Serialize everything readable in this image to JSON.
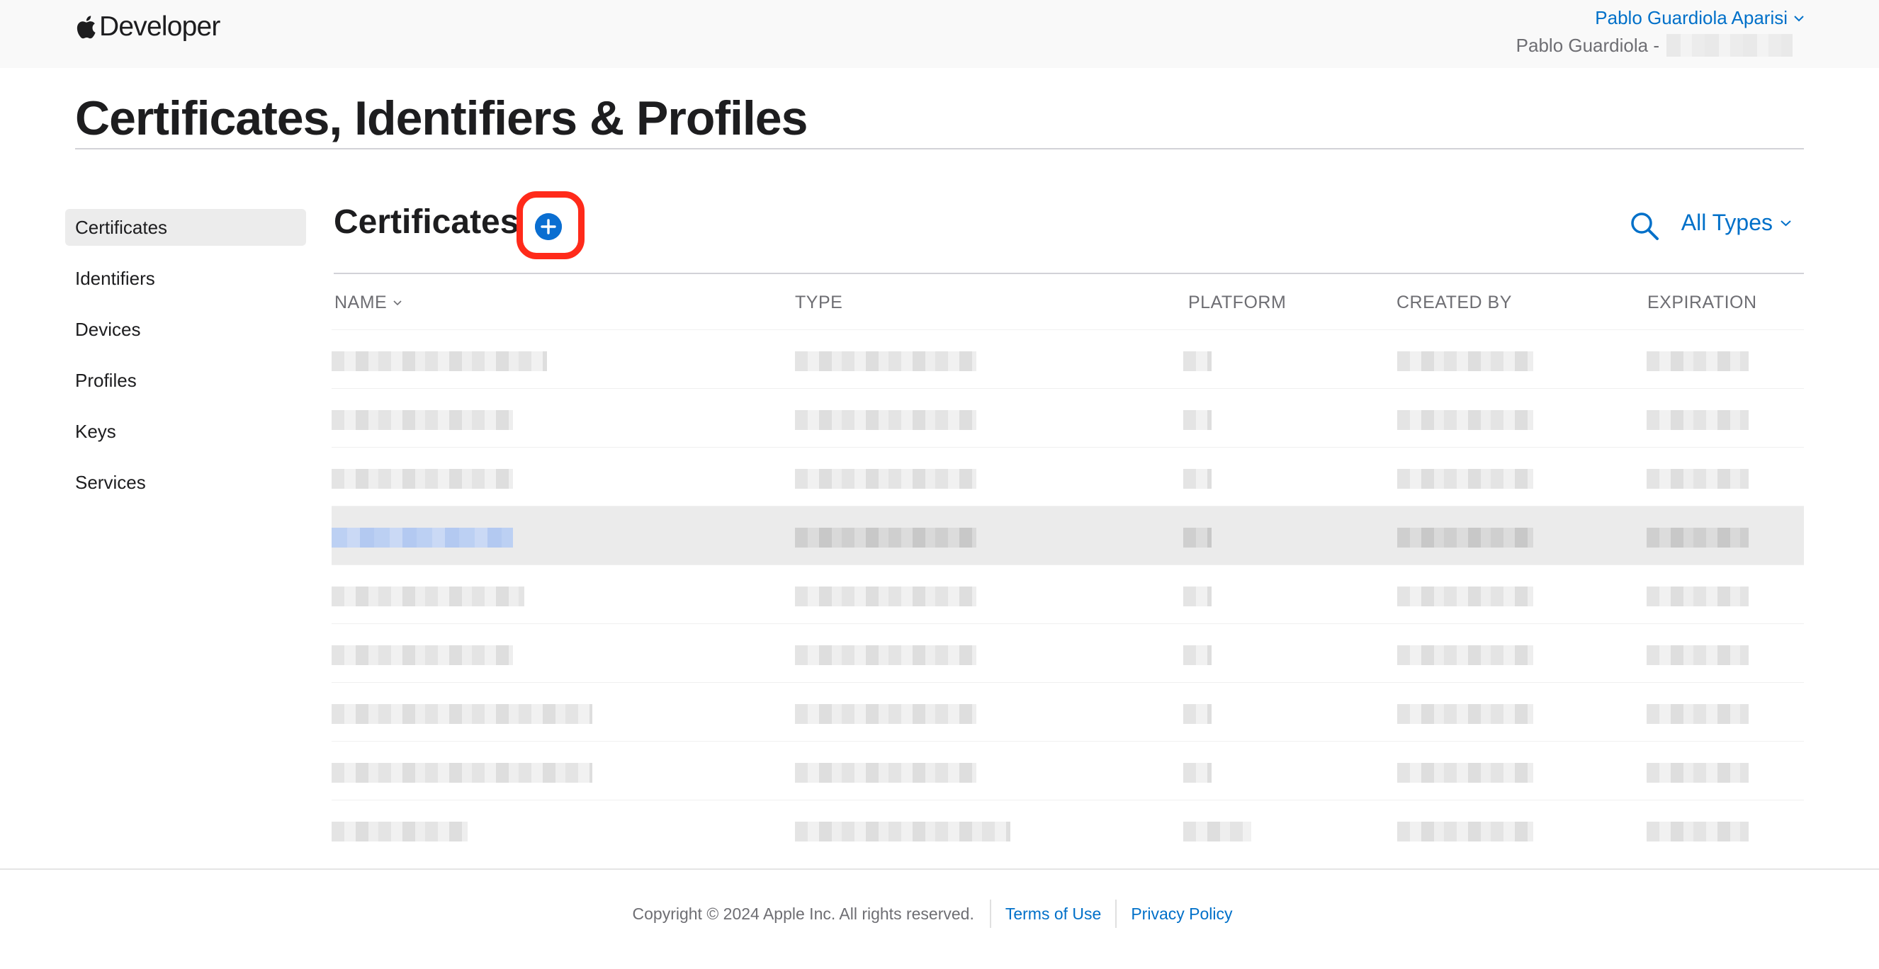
{
  "header": {
    "brand": "Developer",
    "account_name": "Pablo Guardiola Aparisi",
    "team_label": "Pablo Guardiola -"
  },
  "page": {
    "title": "Certificates, Identifiers & Profiles"
  },
  "sidebar": {
    "items": [
      {
        "label": "Certificates",
        "active": true
      },
      {
        "label": "Identifiers",
        "active": false
      },
      {
        "label": "Devices",
        "active": false
      },
      {
        "label": "Profiles",
        "active": false
      },
      {
        "label": "Keys",
        "active": false
      },
      {
        "label": "Services",
        "active": false
      }
    ]
  },
  "content": {
    "section_title": "Certificates",
    "add_icon": "plus-circle-icon",
    "search_icon": "search-icon",
    "filter_label": "All Types"
  },
  "table": {
    "columns": [
      "NAME",
      "TYPE",
      "PLATFORM",
      "CREATED BY",
      "EXPIRATION"
    ],
    "sort_indicator": "chevron-down-icon",
    "highlighted_row": 3,
    "rows_note_redacted": true
  },
  "footer": {
    "copyright": "Copyright © 2024 Apple Inc. All rights reserved.",
    "terms": "Terms of Use",
    "privacy": "Privacy Policy"
  },
  "colors": {
    "accent": "#0070c9",
    "add_button": "#0a6ed1",
    "annotation_red": "#ff2a1a",
    "text": "#1d1d1f",
    "muted": "#6e6e73"
  }
}
